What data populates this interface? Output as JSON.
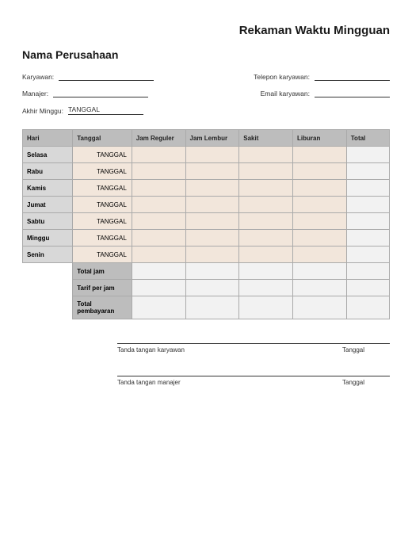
{
  "title": "Rekaman Waktu Mingguan",
  "company": "Nama Perusahaan",
  "fields": {
    "employee": "Karyawan:",
    "phone": "Telepon karyawan:",
    "manager": "Manajer:",
    "email": "Email karyawan:",
    "week_end": "Akhir Minggu:",
    "week_end_value": "TANGGAL"
  },
  "headers": {
    "day": "Hari",
    "date": "Tanggal",
    "regular": "Jam Reguler",
    "overtime": "Jam Lembur",
    "sick": "Sakit",
    "holiday": "Liburan",
    "total": "Total"
  },
  "rows": [
    {
      "day": "Selasa",
      "date": "TANGGAL"
    },
    {
      "day": "Rabu",
      "date": "TANGGAL"
    },
    {
      "day": "Kamis",
      "date": "TANGGAL"
    },
    {
      "day": "Jumat",
      "date": "TANGGAL"
    },
    {
      "day": "Sabtu",
      "date": "TANGGAL"
    },
    {
      "day": "Minggu",
      "date": "TANGGAL"
    },
    {
      "day": "Senin",
      "date": "TANGGAL"
    }
  ],
  "summary": {
    "total_hours": "Total jam",
    "rate": "Tarif per jam",
    "total_pay": "Total pembayaran"
  },
  "signatures": {
    "employee": "Tanda tangan karyawan",
    "manager": "Tanda tangan manajer",
    "date": "Tanggal"
  }
}
